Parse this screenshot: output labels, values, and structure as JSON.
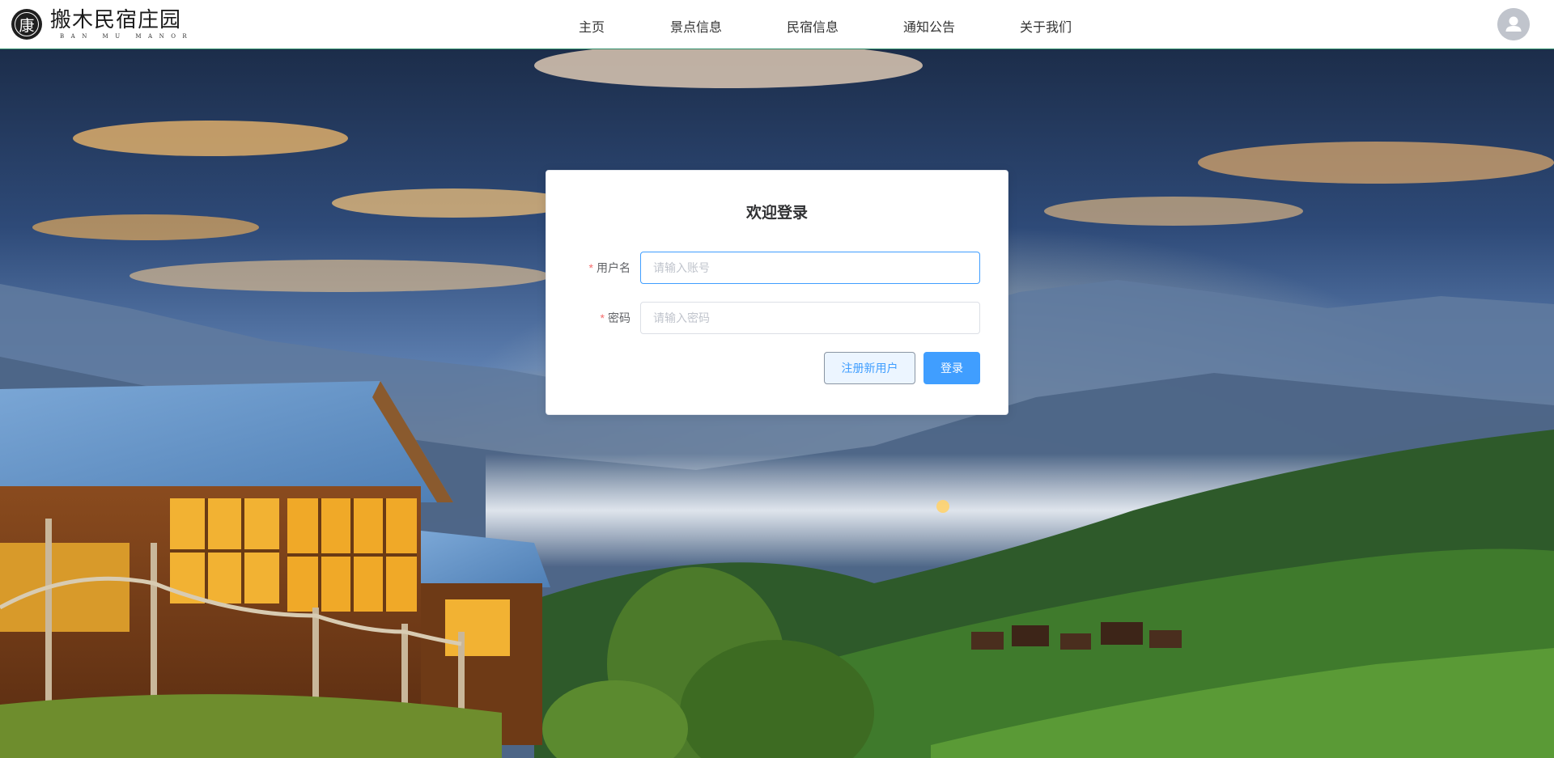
{
  "logo": {
    "mark_glyph": "康",
    "name": "搬木民宿庄园",
    "subtitle": "BAN MU MANOR"
  },
  "nav": {
    "items": [
      {
        "label": "主页"
      },
      {
        "label": "景点信息"
      },
      {
        "label": "民宿信息"
      },
      {
        "label": "通知公告"
      },
      {
        "label": "关于我们"
      }
    ]
  },
  "user": {
    "avatar_icon": "user-avatar-icon"
  },
  "login": {
    "title": "欢迎登录",
    "username": {
      "label": "用户名",
      "required_mark": "*",
      "placeholder": "请输入账号",
      "value": ""
    },
    "password": {
      "label": "密码",
      "required_mark": "*",
      "placeholder": "请输入密码",
      "value": ""
    },
    "register_label": "注册新用户",
    "login_label": "登录"
  },
  "colors": {
    "primary": "#409eff",
    "required": "#f56c6c",
    "header_border": "#2f8f6a"
  }
}
